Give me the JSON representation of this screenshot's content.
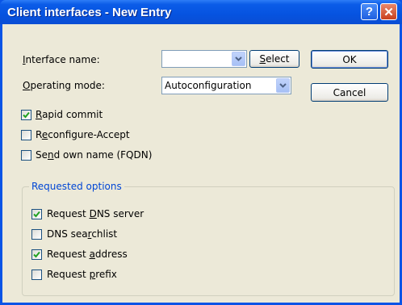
{
  "window": {
    "title": "Client interfaces - New Entry",
    "help_symbol": "?",
    "close_symbol": "✕"
  },
  "form": {
    "interface_name": {
      "label_prefix": "",
      "label_underlined": "I",
      "label_rest": "nterface name:",
      "value": ""
    },
    "select_button": {
      "underlined": "S",
      "rest": "elect"
    },
    "operating_mode": {
      "label_prefix": "",
      "label_underlined": "O",
      "label_rest": "perating mode:",
      "value": "Autoconfiguration"
    },
    "ok_button": "OK",
    "cancel_button": "Cancel",
    "checkboxes": [
      {
        "prefix": "",
        "underlined": "R",
        "rest": "apid commit",
        "checked": true
      },
      {
        "prefix": "R",
        "underlined": "e",
        "rest": "configure-Accept",
        "checked": false
      },
      {
        "prefix": "Se",
        "underlined": "n",
        "rest": "d own name (FQDN)",
        "checked": false
      }
    ]
  },
  "requested_options": {
    "legend": "Requested options",
    "checkboxes": [
      {
        "prefix": "Request ",
        "underlined": "D",
        "rest": "NS server",
        "checked": true
      },
      {
        "prefix": "DNS sea",
        "underlined": "r",
        "rest": "chlist",
        "checked": false
      },
      {
        "prefix": "Request ",
        "underlined": "a",
        "rest": "ddress",
        "checked": true
      },
      {
        "prefix": "Request ",
        "underlined": "p",
        "rest": "refix",
        "checked": false
      }
    ]
  },
  "colors": {
    "titlebar": "#0653e0",
    "dialog_bg": "#ece9d8",
    "groupbox_legend": "#0046d5"
  }
}
